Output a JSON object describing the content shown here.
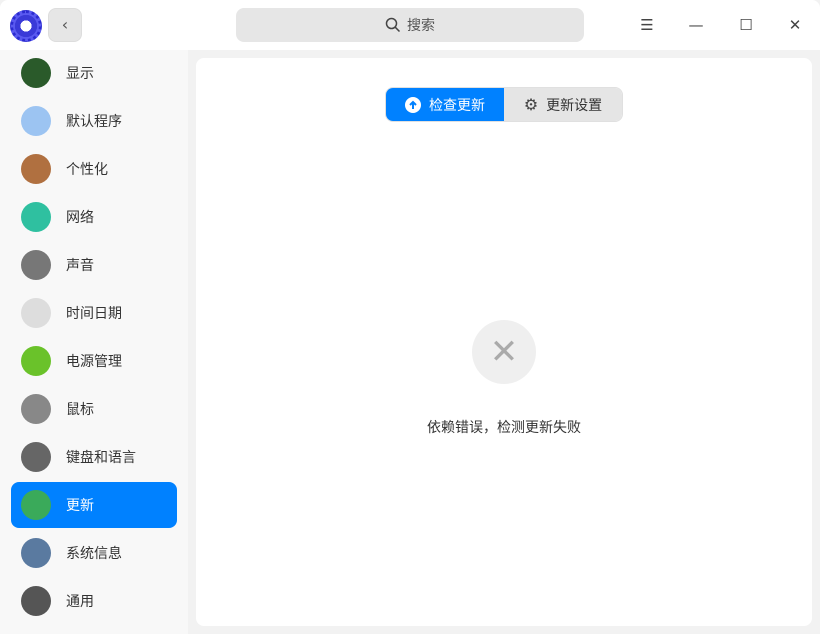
{
  "titlebar": {
    "search_placeholder": "搜索",
    "back": "‹"
  },
  "sidebar": {
    "items": [
      {
        "label": "显示",
        "color": "#2a5a2a"
      },
      {
        "label": "默认程序",
        "color": "#9cc4f2"
      },
      {
        "label": "个性化",
        "color": "#b07040"
      },
      {
        "label": "网络",
        "color": "#2fc0a0"
      },
      {
        "label": "声音",
        "color": "#777777"
      },
      {
        "label": "时间日期",
        "color": "#dddddd"
      },
      {
        "label": "电源管理",
        "color": "#6ac22a"
      },
      {
        "label": "鼠标",
        "color": "#888888"
      },
      {
        "label": "键盘和语言",
        "color": "#666666"
      },
      {
        "label": "更新",
        "color": "#3aaa5a"
      },
      {
        "label": "系统信息",
        "color": "#5a7aa0"
      },
      {
        "label": "通用",
        "color": "#555555"
      }
    ],
    "active": "更新"
  },
  "main": {
    "tab_check": "检查更新",
    "tab_settings": "更新设置",
    "error_message": "依赖错误，检测更新失败"
  },
  "colors": {
    "accent": "#0081ff"
  }
}
